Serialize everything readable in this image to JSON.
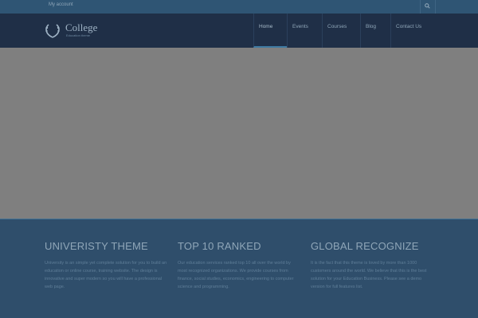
{
  "topbar": {
    "account_label": "My account",
    "search_icon": "search-icon"
  },
  "header": {
    "logo_name": "College",
    "logo_tagline": "Education theme",
    "logo_icon": "laurel-wreath-icon",
    "nav": [
      {
        "label": "Home",
        "active": true
      },
      {
        "label": "Events",
        "active": false
      },
      {
        "label": "Courses",
        "active": false
      },
      {
        "label": "Blog",
        "active": false
      },
      {
        "label": "Contact Us",
        "active": false
      }
    ]
  },
  "features": [
    {
      "title": "UNIVERISTY THEME",
      "text": "University is an simple yet complete solution for you to build an education or online course, training website. The design is innovative and super modern so you will have a professional web page."
    },
    {
      "title": "TOP 10 RANKED",
      "text": "Our education services ranked top 10 all over the world by most recognized organizations. We provide courses from finance, social studies, economics, engineering to computer science and programming."
    },
    {
      "title": "GLOBAL RECOGNIZE",
      "text": "It is the fact that this theme is loved by more than 1000 customers around the world. We believe that this is the best solution for your Education Business. Please see a demo version for full features list."
    }
  ],
  "colors": {
    "topbar": "#2f5574",
    "header": "#1f2f47",
    "hero": "#7f7f7f",
    "features": "#2f4e6b",
    "accent": "#3e7aa2"
  }
}
